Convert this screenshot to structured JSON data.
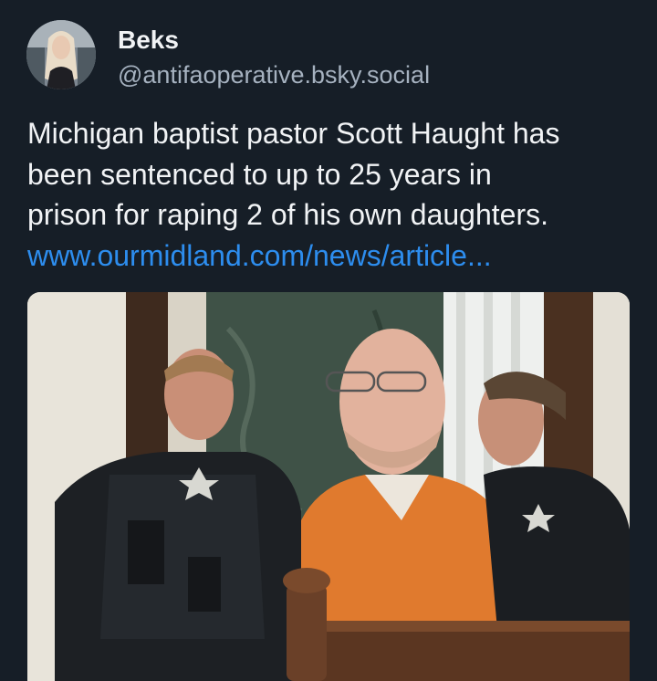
{
  "author": {
    "display_name": "Beks",
    "handle": "@antifaoperative.bsky.social",
    "avatar_icon": "user-avatar-photo"
  },
  "post": {
    "text_lines": [
      "Michigan baptist pastor Scott Haught has",
      "been sentenced to up to 25 years in",
      "prison for raping 2 of his own daughters."
    ],
    "link_text": "www.ourmidland.com/news/article..."
  },
  "media": {
    "image_kind": "courtroom-photo"
  },
  "colors": {
    "background": "#161e27",
    "text": "#f1f3f5",
    "handle": "#a6b2c0",
    "link": "#2d8dee"
  }
}
